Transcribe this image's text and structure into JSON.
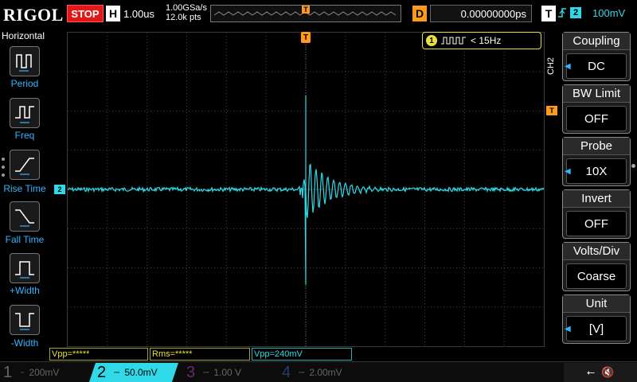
{
  "brand": "RIGOL",
  "run_state": "STOP",
  "timebase": {
    "label": "H",
    "value": "1.00us",
    "sample_rate": "1.00GSa/s",
    "memory_depth": "12.0k pts"
  },
  "trigger_marker": "T",
  "delay": {
    "label": "D",
    "value": "0.00000000ps"
  },
  "trigger": {
    "label": "T",
    "source": "2",
    "level": "100mV"
  },
  "left_menu": {
    "title": "Horizontal",
    "items": [
      {
        "label": "Period",
        "icon": "period-icon"
      },
      {
        "label": "Freq",
        "icon": "freq-icon"
      },
      {
        "label": "Rise Time",
        "icon": "rise-time-icon"
      },
      {
        "label": "Fall Time",
        "icon": "fall-time-icon"
      },
      {
        "label": "+Width",
        "icon": "positive-width-icon"
      },
      {
        "label": "-Width",
        "icon": "negative-width-icon"
      }
    ]
  },
  "frequency_counter": {
    "channel": "1",
    "value": "< 15Hz"
  },
  "ch2_side_label": "CH2",
  "ch2_marker": "2",
  "trigger_level_marker": "T",
  "right_menu": {
    "items": [
      {
        "title": "Coupling",
        "value": "DC"
      },
      {
        "title": "BW Limit",
        "value": "OFF"
      },
      {
        "title": "Probe",
        "value": "10X"
      },
      {
        "title": "Invert",
        "value": "OFF"
      },
      {
        "title": "Volts/Div",
        "value": "Coarse"
      },
      {
        "title": "Unit",
        "value": "[V]"
      }
    ]
  },
  "measurements": [
    {
      "text": "Vpp=*****"
    },
    {
      "text": "Rms=*****"
    },
    {
      "text": "Vpp=240mV"
    }
  ],
  "channels": [
    {
      "num": "1",
      "scale": "200mV",
      "color": "#e8e040",
      "active": false
    },
    {
      "num": "2",
      "scale": "50.0mV",
      "color": "#2fd9e8",
      "active": true
    },
    {
      "num": "3",
      "scale": "1.00 V",
      "color": "#e040e0",
      "active": false
    },
    {
      "num": "4",
      "scale": "2.00mV",
      "color": "#3a7bff",
      "active": false
    }
  ],
  "colors": {
    "ch2": "#2fd9e8",
    "trigger": "#ff9a1a",
    "grid": "#555555"
  }
}
